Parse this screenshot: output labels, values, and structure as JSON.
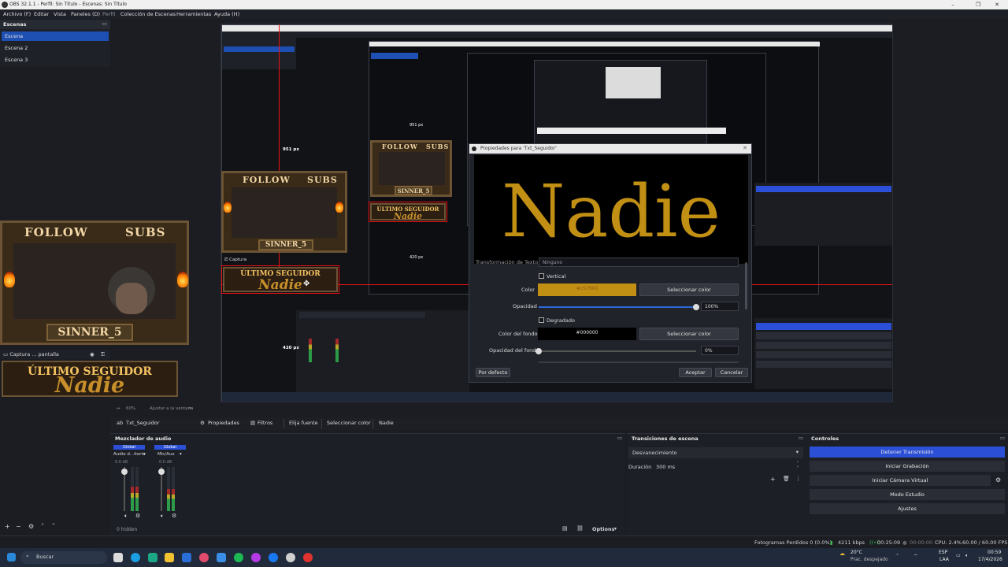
{
  "window": {
    "title": "OBS 32.1.1 - Perfil: Sin Título - Escenas: Sin Título",
    "controls": [
      "–",
      "❐",
      "✕"
    ]
  },
  "menu": [
    "Archivo (F)",
    "Editar",
    "Vista",
    "Paneles (D)",
    "Perfil",
    "Colección de Escenas",
    "Herramientas",
    "Ayuda (H)"
  ],
  "scenes": {
    "header": "Escenas",
    "items": [
      "Escena",
      "Escena 2",
      "Escena 3"
    ],
    "active_index": 0
  },
  "overlay": {
    "follow": "FOLLOW",
    "subs": "SUBS",
    "name": "SINNER_5",
    "banner_title": "ÚLTIMO SEGUIDOR",
    "banner_name": "Nadie"
  },
  "canvas": {
    "measure_h": "951 px",
    "measure_v": "420 px",
    "capture_label": "Captura ... pantalla"
  },
  "dialog": {
    "title": "Propiedades para 'Txt_Seguidor'",
    "preview_text": "Nadie",
    "transform_label": "Transformación de Texto",
    "transform_value": "Ninguno",
    "vertical_label": "Vertical",
    "color_label": "Color",
    "color_value": "#c18f14",
    "color_hex_text": "#c57900",
    "select_color": "Seleccionar color",
    "opacity_label": "Opacidad",
    "opacity_value": "100%",
    "opacity_level": 1.0,
    "gradient_label": "Degradado",
    "bgcolor_label": "Color del fondo",
    "bgcolor_value": "#000000",
    "bgopacity_label": "Opacidad del fondo",
    "bgopacity_value": "0%",
    "bgopacity_level": 0.0,
    "defaults": "Por defecto",
    "accept": "Aceptar",
    "cancel": "Cancelar"
  },
  "source_toolbar": {
    "source": "Txt_Seguidor",
    "properties": "Propiedades",
    "filters": "Filtros",
    "choose_source": "Elija fuente",
    "select_color": "Seleccionar color",
    "text": "Nadie"
  },
  "scale_row": {
    "zoom": "60%",
    "fit": "Ajustar a la ventana"
  },
  "mixer": {
    "header": "Mezclador de audio",
    "channels": [
      {
        "tag": "Global",
        "name": "Audio d...itorio",
        "db": "0.0 dB",
        "level": 0.55
      },
      {
        "tag": "Global",
        "name": "Mic/Aux",
        "db": "0.0 dB",
        "level": 0.5
      }
    ],
    "hidden": "0 hidden",
    "options": "Options"
  },
  "transitions": {
    "header": "Transiciones de escena",
    "type": "Desvanecimiento",
    "duration_label": "Duración",
    "duration_value": "300 ms"
  },
  "controls": {
    "header": "Controles",
    "buttons": [
      "Detener Transmisión",
      "Iniciar Grabación",
      "Iniciar Cámara Virtual",
      "Modo Estudio",
      "Ajustes"
    ]
  },
  "status": {
    "dropped": "Fotogramas Perdidos 0 (0.0%)",
    "kbps": "4211 kbps",
    "live_time": "00:25:09",
    "rec_time": "00:00:00",
    "cpu": "CPU: 2.4%",
    "fps": "60.00 / 60.00 FPS"
  },
  "taskbar": {
    "search": "Buscar",
    "weather_temp": "20°C",
    "weather_desc": "Prac. despejado",
    "lang_top": "ESP",
    "lang_bottom": "LAA",
    "time": "00:59",
    "date": "17/4/2026"
  },
  "colors": {
    "accent": "#1e4fb3",
    "stream_button": "#2b4fd6",
    "text_gold": "#c18f14",
    "selection_red": "#e11111"
  }
}
